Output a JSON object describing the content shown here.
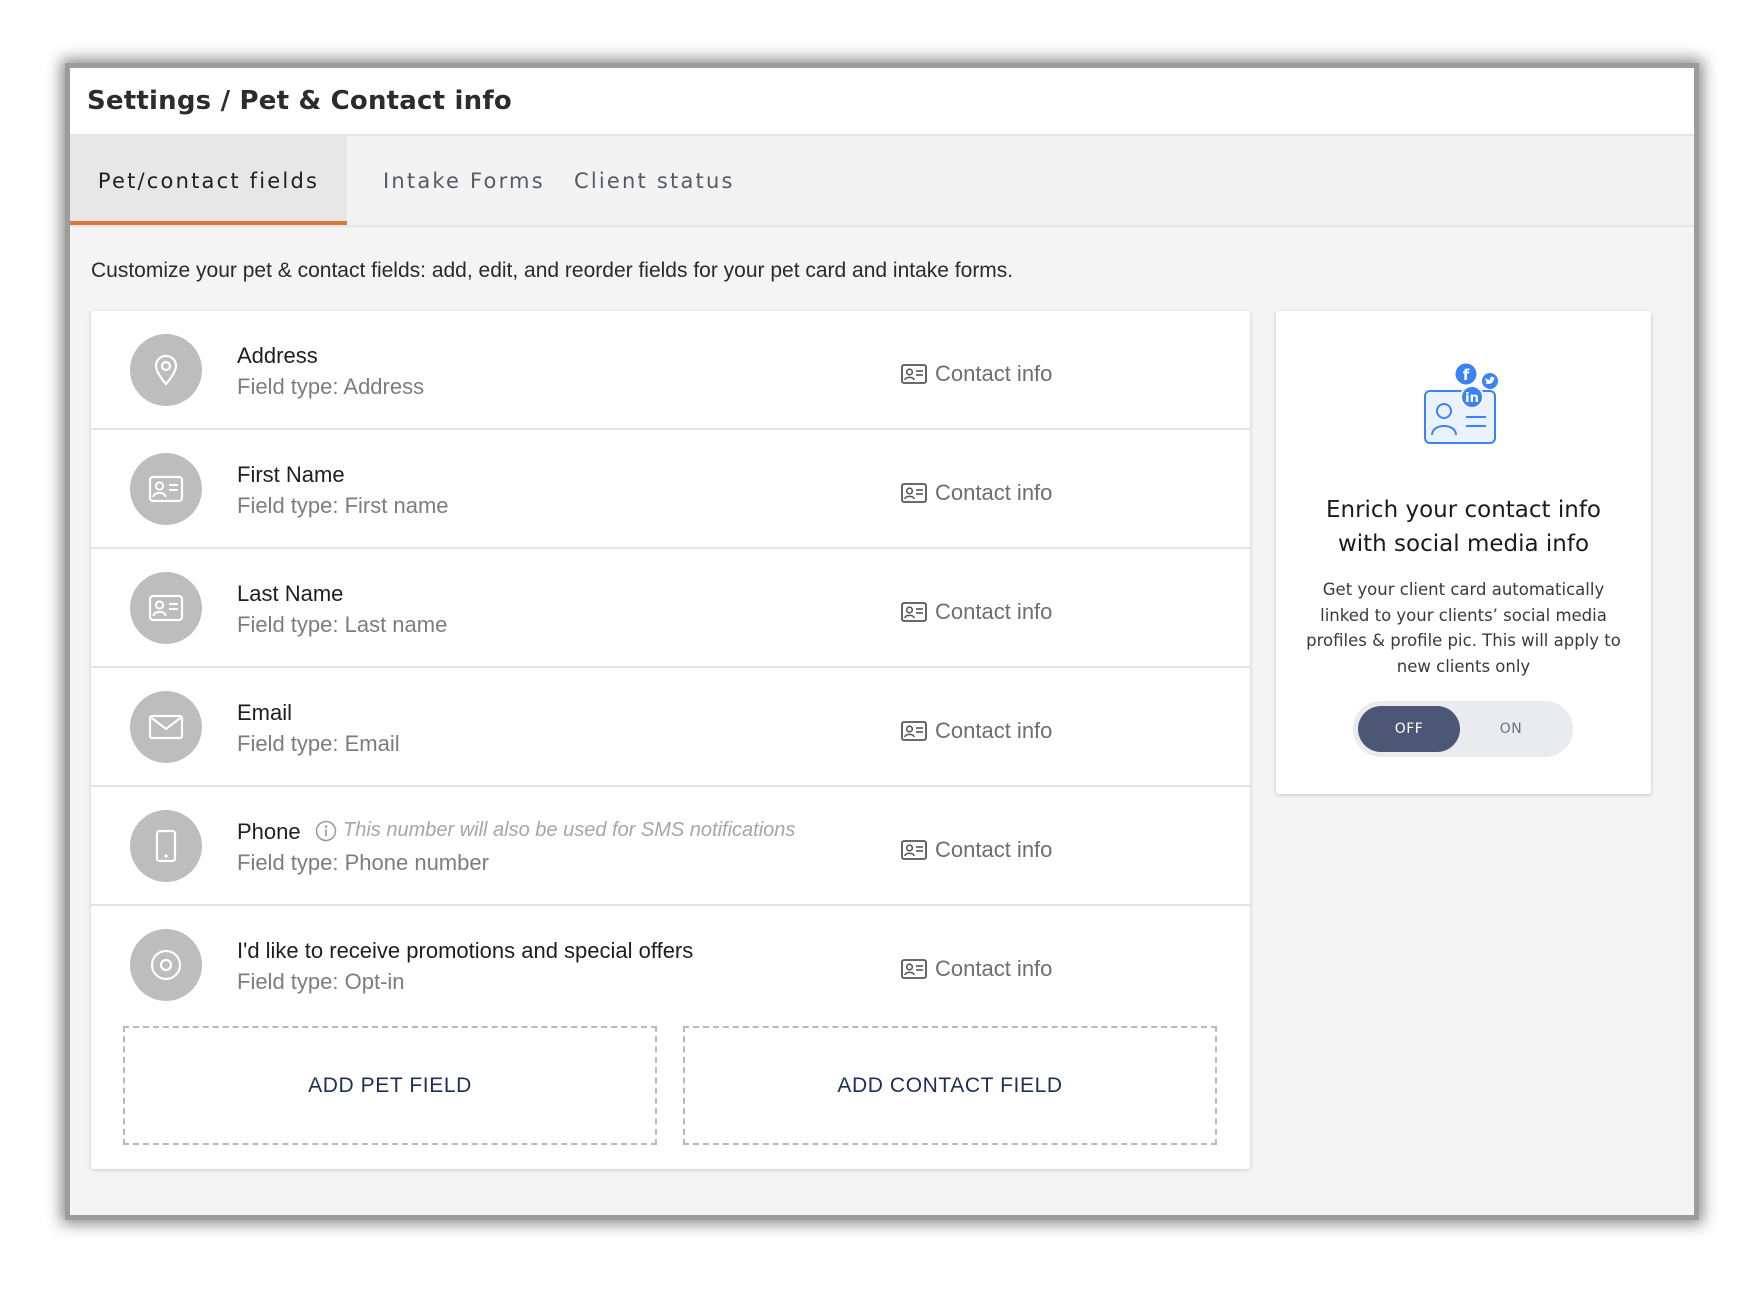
{
  "header": {
    "title": "Settings / Pet & Contact info"
  },
  "tabs": [
    {
      "label": "Pet/contact fields",
      "active": true
    },
    {
      "label": "Intake Forms",
      "active": false
    },
    {
      "label": "Client status",
      "active": false
    }
  ],
  "description": "Customize your pet & contact fields: add, edit, and reorder fields for your pet card and intake forms.",
  "fields": [
    {
      "name": "Address",
      "type": "Field type: Address",
      "category": "Contact info",
      "icon": "location-pin-icon"
    },
    {
      "name": "First Name",
      "type": "Field type: First name",
      "category": "Contact info",
      "icon": "id-card-icon"
    },
    {
      "name": "Last Name",
      "type": "Field type: Last name",
      "category": "Contact info",
      "icon": "id-card-icon"
    },
    {
      "name": "Email",
      "type": "Field type: Email",
      "category": "Contact info",
      "icon": "envelope-icon"
    },
    {
      "name": "Phone",
      "type": "Field type: Phone number",
      "category": "Contact info",
      "icon": "mobile-phone-icon",
      "note": "This number will also be used for SMS notifications"
    },
    {
      "name": "I'd like to receive promotions and special offers",
      "type": "Field type: Opt-in",
      "category": "Contact info",
      "icon": "radio-target-icon"
    }
  ],
  "buttons": {
    "add_pet": "ADD PET FIELD",
    "add_contact": "ADD CONTACT FIELD"
  },
  "promo": {
    "title": "Enrich your contact info with social media info",
    "body": "Get your client card automatically linked to your clients’ social media profiles & profile pic. This will apply to new clients only",
    "toggle_off": "OFF",
    "toggle_on": "ON",
    "toggle_state": "OFF",
    "illustration_icons": [
      "facebook-icon",
      "linkedin-icon",
      "twitter-icon",
      "contact-card-icon"
    ]
  },
  "colors": {
    "tab_accent": "#d67a3b",
    "button_text": "#1d2f55",
    "toggle_active": "#4d5775",
    "social_blue": "#3b82f6"
  }
}
